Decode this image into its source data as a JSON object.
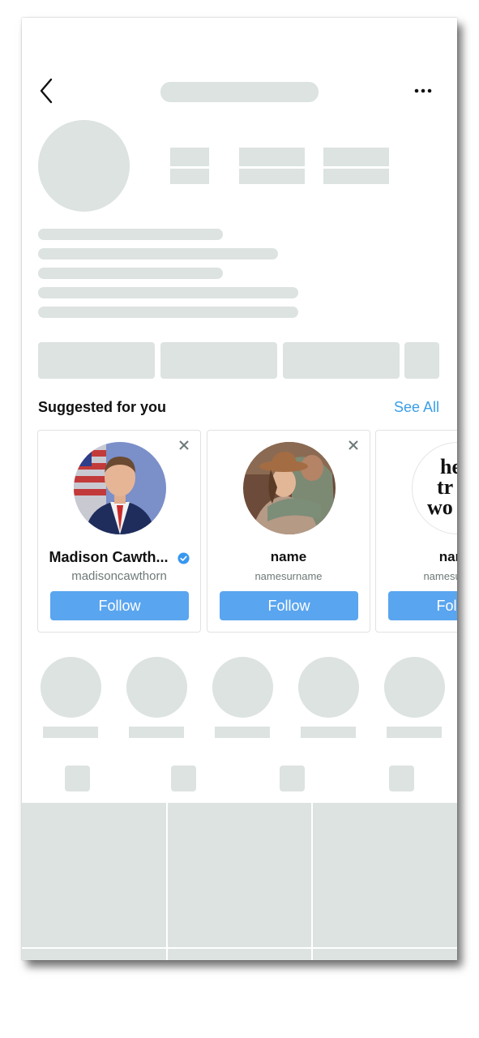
{
  "header": {
    "back_icon": "chevron-left-icon",
    "more_icon": "ellipsis-icon"
  },
  "suggested": {
    "title": "Suggested for you",
    "see_all": "See All",
    "cards": [
      {
        "name": "Madison Cawth...",
        "handle": "madisoncawthorn",
        "follow": "Follow",
        "verified": true
      },
      {
        "name": "name",
        "handle": "namesurname",
        "follow": "Follow",
        "verified": false
      },
      {
        "name": "name",
        "handle": "namesurname",
        "follow": "Follow",
        "verified": false,
        "avatar_text": "he tr wo"
      }
    ]
  },
  "colors": {
    "skeleton": "#dce3e1",
    "accent": "#3a9ee8",
    "follow_button": "#5aa5ef",
    "verified": "#3897f0"
  }
}
